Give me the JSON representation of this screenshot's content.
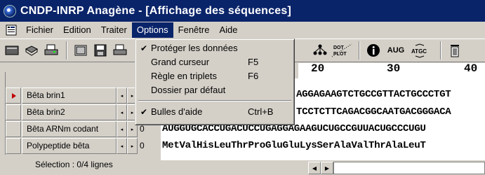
{
  "window": {
    "title": "CNDP-INRP Anagène - [Affichage des séquences]"
  },
  "menubar": {
    "items": [
      "Fichier",
      "Edition",
      "Traiter",
      "Options",
      "Fenêtre",
      "Aide"
    ],
    "active": "Options"
  },
  "toolbar": {
    "dotplot_label": "DOT\nPLOT",
    "aug_label": "AUG",
    "atgc_label": "ATGC"
  },
  "ruler": {
    "ticks": [
      "20",
      "30",
      "40"
    ]
  },
  "rows": [
    {
      "name": "Bêta brin1",
      "num": "",
      "seq": "AGGAGAAGTCTGCCGTTACTGCCCTGT",
      "current": true
    },
    {
      "name": "Bêta brin2",
      "num": "",
      "seq": "TCCTCTTCAGACGGCAATGACGGGACA",
      "current": false
    },
    {
      "name": "Bêta ARNm codant",
      "num": "0",
      "seq": "AUGGUGCACCUGACUCCUGAGGAGAAGUCUGCCGUUACUGCCCUGU",
      "current": false
    },
    {
      "name": "Polypeptide bêta",
      "num": "0",
      "seq": "MetValHisLeuThrProGluGluLysSerAlaValThrAlaLeuT",
      "current": false
    }
  ],
  "status": {
    "selection": "Sélection : 0/4 lignes"
  },
  "options_menu": {
    "items": [
      {
        "label": "Protéger les données",
        "checked": true,
        "shortcut": ""
      },
      {
        "label": "Grand curseur",
        "checked": false,
        "shortcut": "F5"
      },
      {
        "label": "Règle en triplets",
        "checked": false,
        "shortcut": "F6"
      },
      {
        "label": "Dossier par défaut",
        "checked": false,
        "shortcut": ""
      },
      {
        "label": "Bulles d'aide",
        "checked": true,
        "shortcut": "Ctrl+B"
      }
    ]
  }
}
